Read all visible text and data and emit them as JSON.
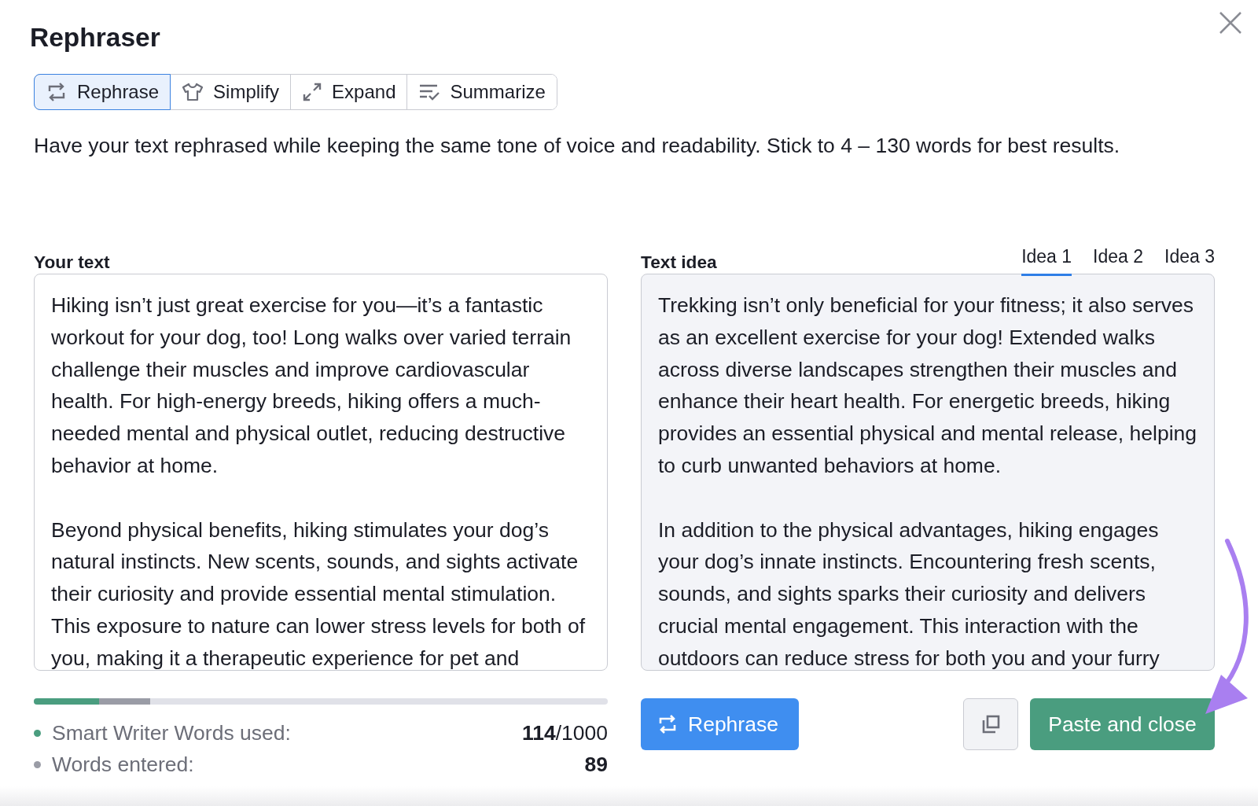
{
  "dialog": {
    "title": "Rephraser"
  },
  "modes": [
    {
      "label": "Rephrase",
      "kind": "rephrase",
      "selected": true
    },
    {
      "label": "Simplify",
      "kind": "simplify",
      "selected": false
    },
    {
      "label": "Expand",
      "kind": "expand",
      "selected": false
    },
    {
      "label": "Summarize",
      "kind": "summarize",
      "selected": false
    }
  ],
  "description": "Have your text rephrased while keeping the same tone of voice and readability. Stick to 4 – 130 words for best results.",
  "your_text": {
    "label": "Your text",
    "paragraphs": [
      "Hiking isn’t just great exercise for you—it’s a fantastic workout for your dog, too! Long walks over varied terrain challenge their muscles and improve cardiovascular health. For high-energy breeds, hiking offers a much-needed mental and physical outlet, reducing destructive behavior at home.",
      "Beyond physical benefits, hiking stimulates your dog’s natural instincts. New scents, sounds, and sights activate their curiosity and provide essential mental stimulation. This exposure to nature can lower stress levels for both of you, making it a therapeutic experience for pet and"
    ]
  },
  "text_idea": {
    "label": "Text idea",
    "tabs": [
      {
        "label": "Idea 1",
        "selected": true
      },
      {
        "label": "Idea 2",
        "selected": false
      },
      {
        "label": "Idea 3",
        "selected": false
      }
    ],
    "paragraphs": [
      "Trekking isn’t only beneficial for your fitness; it also serves as an excellent exercise for your dog! Extended walks across diverse landscapes strengthen their muscles and enhance their heart health. For energetic breeds, hiking provides an essential physical and mental release, helping to curb unwanted behaviors at home.",
      "In addition to the physical advantages, hiking engages your dog’s innate instincts. Encountering fresh scents, sounds, and sights sparks their curiosity and delivers crucial mental engagement. This interaction with the outdoors can reduce stress for both you and your furry"
    ]
  },
  "usage": [
    {
      "label": "Smart Writer Words used:",
      "value": "114",
      "total": "/1000",
      "level": 0.114,
      "color": "#4a9d7f"
    },
    {
      "label": "Words entered:",
      "value": "89",
      "level": 0.089,
      "color": "#9a9ca6"
    }
  ],
  "actions": {
    "rephrase_button": "Rephrase",
    "paste_button": "Paste and close"
  }
}
